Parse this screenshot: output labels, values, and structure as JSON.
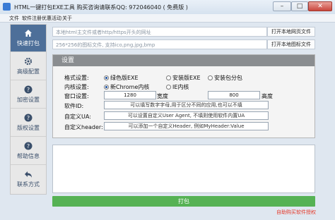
{
  "window": {
    "title": "HTML一键打包EXE工具 购买咨询请联系QQ: 972046040 ( 免费版 )",
    "minimize": "–",
    "maximize": "□",
    "close": "✕"
  },
  "menu": {
    "items": [
      "文件",
      "软件注册",
      "优惠活动",
      "关于"
    ]
  },
  "sidebar": {
    "items": [
      {
        "label": "快速打包",
        "icon": "home-icon"
      },
      {
        "label": "高级配置",
        "icon": "gear-icon"
      },
      {
        "label": "加密设置",
        "icon": "help-circle-icon"
      },
      {
        "label": "版权设置",
        "icon": "help-circle-icon"
      },
      {
        "label": "帮助信息",
        "icon": "help-circle-icon"
      },
      {
        "label": "联系方式",
        "icon": "back-arrow-icon"
      }
    ]
  },
  "source": {
    "url_placeholder": "本地html主文件或者http/https开头的网址",
    "url_button": "打开本地网页文件",
    "icon_placeholder": "256*256的图标文件, 支持ico,png,jpg,bmp",
    "icon_button": "打开本地图标文件"
  },
  "settings": {
    "header": "设置",
    "format_label": "格式设置:",
    "format_options": [
      "绿色版EXE",
      "安装版EXE",
      "安装包分包"
    ],
    "format_selected": 0,
    "kernel_label": "内核设置:",
    "kernel_options": [
      "新Chrome内核",
      "IE内核"
    ],
    "kernel_selected": 0,
    "window_label": "窗口设置:",
    "width_value": "1280",
    "width_suffix": "宽度",
    "height_value": "800",
    "height_suffix": "高度",
    "softid_label": "软件ID:",
    "softid_value": "可以填写数字字母,用于区分不同的应用,也可以不填",
    "ua_label": "自定义UA:",
    "ua_value": "可以设置自定义User Agent, 不填则使用软件内置UA",
    "header_label": "自定义header:",
    "header_value": "可以添加一个自定义Header, 例如MyHeader:Value"
  },
  "pack_button": "打包",
  "license_text": "自助购买软件授权",
  "colors": {
    "accent": "#4d6f99",
    "pack": "#56b254",
    "license": "#e53b2c"
  }
}
